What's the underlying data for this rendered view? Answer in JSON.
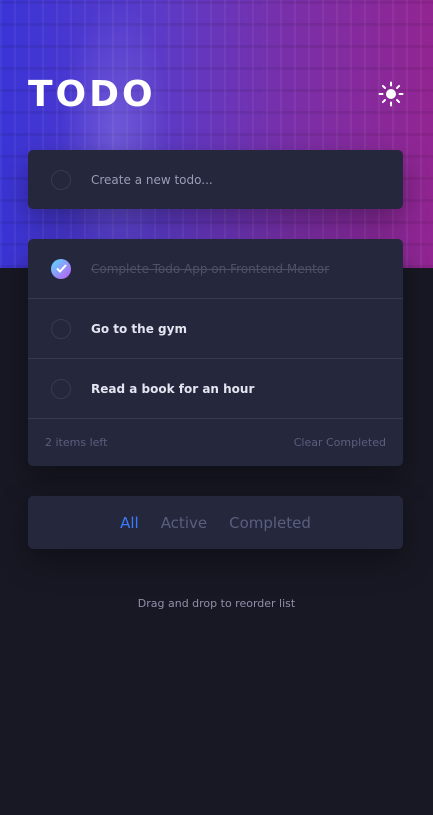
{
  "app": {
    "title": "TODO",
    "theme_toggle_icon": "sun-icon"
  },
  "new_todo": {
    "placeholder": "Create a new todo..."
  },
  "todos": [
    {
      "text": "Complete Todo App on Frontend Mentor",
      "completed": true
    },
    {
      "text": "Go to the gym",
      "completed": false
    },
    {
      "text": "Read a book for an hour",
      "completed": false
    }
  ],
  "footer": {
    "items_left": "2 items left",
    "clear_label": "Clear Completed"
  },
  "filters": {
    "all": "All",
    "active": "Active",
    "completed": "Completed",
    "selected": "All"
  },
  "hint": "Drag and drop to reorder list",
  "colors": {
    "background": "#181824",
    "card": "#25273c",
    "accent": "#3a7cfd",
    "check_gradient_start": "#57ddff",
    "check_gradient_end": "#c058f3"
  }
}
